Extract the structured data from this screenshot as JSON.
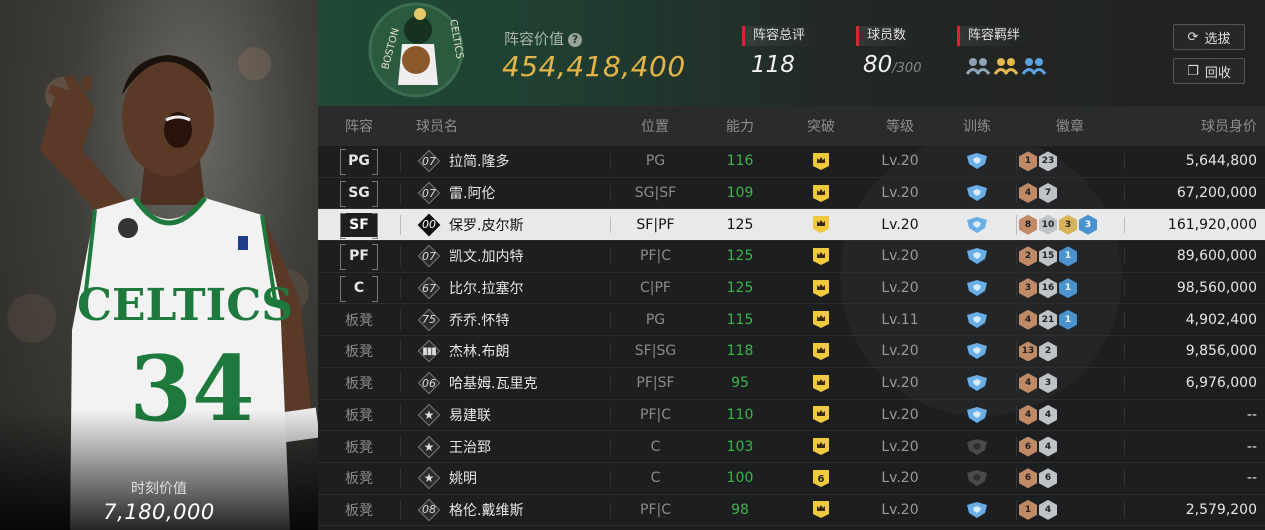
{
  "portrait": {
    "jersey_text": "CELTICS",
    "jersey_number": "34",
    "moment_value_label": "时刻价值",
    "moment_value": "7,180,000"
  },
  "header": {
    "lineup_value_label": "阵容价值",
    "lineup_value": "454,418,400",
    "overall_label": "阵容总评",
    "overall_value": "118",
    "players_label": "球员数",
    "players_value": "80",
    "players_max": "/300",
    "bond_label": "阵容羁绊",
    "select_button": "选拔",
    "recycle_button": "回收",
    "logo_text_left": "BOSTON",
    "logo_text_right": "CELTICS"
  },
  "columns": [
    "阵容",
    "球员名",
    "位置",
    "能力",
    "突破",
    "等级",
    "训练",
    "徽章",
    "球员身价"
  ],
  "rows": [
    {
      "slot": "PG",
      "num": "07",
      "name": "拉简.隆多",
      "pos": "PG",
      "ability": "116",
      "break": "",
      "level": "Lv.20",
      "train": "blue",
      "badges": [
        [
          "bronze",
          "1"
        ],
        [
          "silver",
          "23"
        ]
      ],
      "value": "5,644,800"
    },
    {
      "slot": "SG",
      "num": "07",
      "name": "雷.阿伦",
      "pos": "SG|SF",
      "ability": "109",
      "break": "",
      "level": "Lv.20",
      "train": "blue",
      "badges": [
        [
          "bronze",
          "4"
        ],
        [
          "silver",
          "7"
        ]
      ],
      "value": "67,200,000"
    },
    {
      "slot": "SF",
      "num": "00",
      "name": "保罗.皮尔斯",
      "pos": "SF|PF",
      "ability": "125",
      "break": "",
      "level": "Lv.20",
      "train": "blue",
      "badges": [
        [
          "bronze",
          "8"
        ],
        [
          "silver",
          "10"
        ],
        [
          "gold",
          "3"
        ],
        [
          "blue",
          "3"
        ]
      ],
      "value": "161,920,000",
      "selected": true
    },
    {
      "slot": "PF",
      "num": "07",
      "name": "凯文.加内特",
      "pos": "PF|C",
      "ability": "125",
      "break": "",
      "level": "Lv.20",
      "train": "blue",
      "badges": [
        [
          "bronze",
          "2"
        ],
        [
          "silver",
          "15"
        ],
        [
          "blue",
          "1"
        ]
      ],
      "value": "89,600,000"
    },
    {
      "slot": "C",
      "num": "67",
      "name": "比尔.拉塞尔",
      "pos": "C|PF",
      "ability": "125",
      "break": "",
      "level": "Lv.20",
      "train": "blue",
      "badges": [
        [
          "bronze",
          "3"
        ],
        [
          "silver",
          "16"
        ],
        [
          "blue",
          "1"
        ]
      ],
      "value": "98,560,000"
    },
    {
      "slot": "板凳",
      "num": "75",
      "name": "乔乔.怀特",
      "pos": "PG",
      "ability": "115",
      "break": "",
      "level": "Lv.11",
      "train": "blue",
      "badges": [
        [
          "bronze",
          "4"
        ],
        [
          "silver",
          "21"
        ],
        [
          "blue",
          "1"
        ]
      ],
      "value": "4,902,400"
    },
    {
      "slot": "板凳",
      "num": "",
      "name": "杰林.布朗",
      "pos": "SF|SG",
      "ability": "118",
      "break": "",
      "level": "Lv.20",
      "train": "blue",
      "badges": [
        [
          "bronze",
          "13"
        ],
        [
          "silver",
          "2"
        ]
      ],
      "value": "9,856,000"
    },
    {
      "slot": "板凳",
      "num": "06",
      "name": "哈基姆.瓦里克",
      "pos": "PF|SF",
      "ability": "95",
      "break": "",
      "level": "Lv.20",
      "train": "blue",
      "badges": [
        [
          "bronze",
          "4"
        ],
        [
          "silver",
          "3"
        ]
      ],
      "value": "6,976,000"
    },
    {
      "slot": "板凳",
      "num": "",
      "name": "易建联",
      "pos": "PF|C",
      "ability": "110",
      "break": "",
      "level": "Lv.20",
      "train": "blue",
      "badges": [
        [
          "bronze",
          "4"
        ],
        [
          "silver",
          "4"
        ]
      ],
      "value": "--"
    },
    {
      "slot": "板凳",
      "num": "",
      "name": "王治郅",
      "pos": "C",
      "ability": "103",
      "break": "",
      "level": "Lv.20",
      "train": "gray",
      "badges": [
        [
          "bronze",
          "6"
        ],
        [
          "silver",
          "4"
        ]
      ],
      "value": "--"
    },
    {
      "slot": "板凳",
      "num": "",
      "name": "姚明",
      "pos": "C",
      "ability": "100",
      "break": "6",
      "level": "Lv.20",
      "train": "gray",
      "badges": [
        [
          "bronze",
          "6"
        ],
        [
          "silver",
          "6"
        ]
      ],
      "value": "--"
    },
    {
      "slot": "板凳",
      "num": "08",
      "name": "格伦.戴维斯",
      "pos": "PF|C",
      "ability": "98",
      "break": "",
      "level": "Lv.20",
      "train": "blue",
      "badges": [
        [
          "bronze",
          "1"
        ],
        [
          "silver",
          "4"
        ]
      ],
      "value": "2,579,200"
    }
  ],
  "num_icons": {
    "6": "bars-icon",
    "8": "star-icon",
    "9": "star-icon",
    "10": "star-icon"
  },
  "colors": {
    "accent_gold": "#e2b449",
    "ability_green": "#3bb54a",
    "stat_red": "#d8262c",
    "selected_row": "#e9e9e9"
  }
}
